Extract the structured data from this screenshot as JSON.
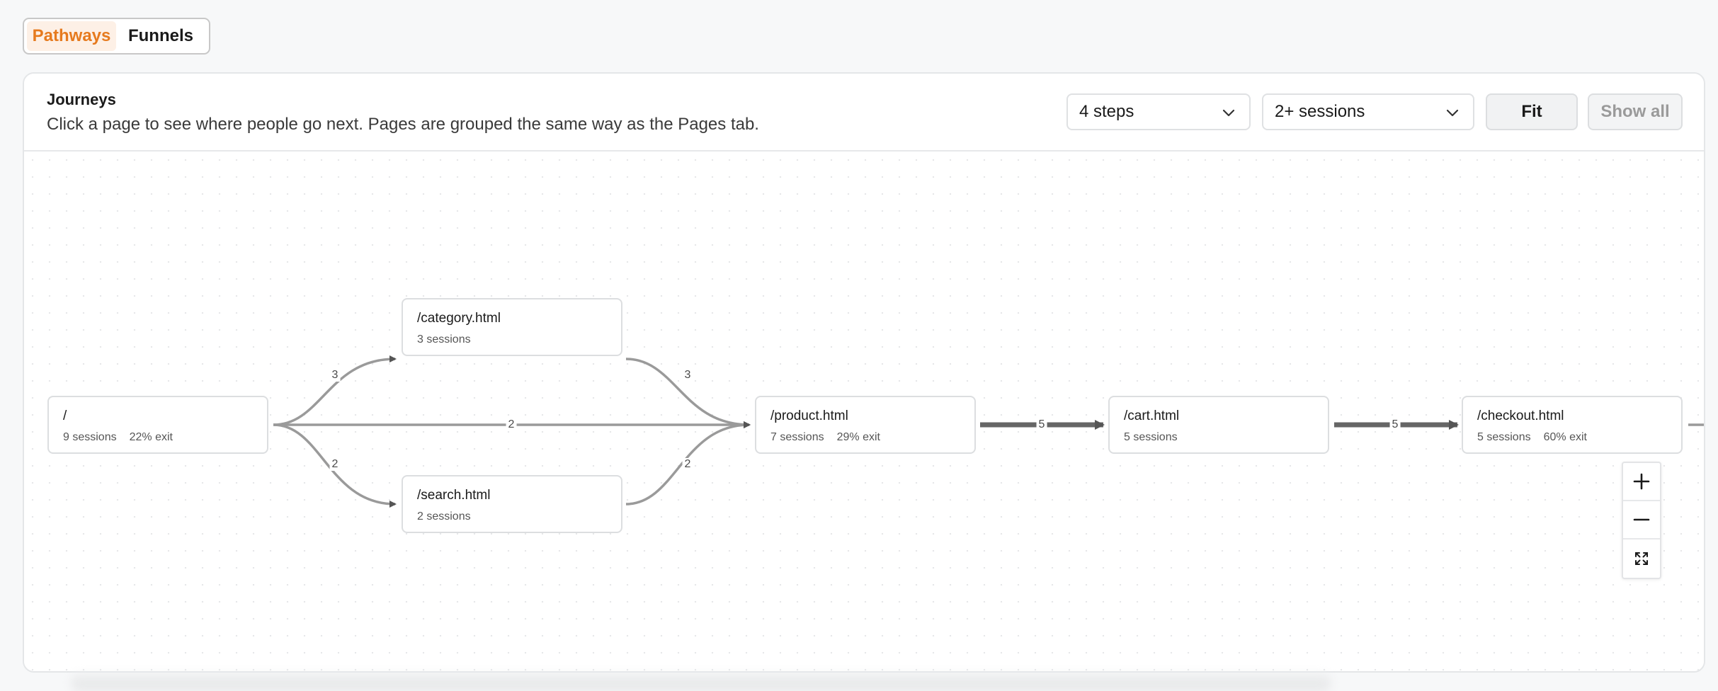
{
  "tabs": {
    "pathways": "Pathways",
    "funnels": "Funnels"
  },
  "panel": {
    "title": "Journeys",
    "subtitle": "Click a page to see where people go next. Pages are grouped the same way as the Pages tab."
  },
  "controls": {
    "steps": "4 steps",
    "sessions": "2+ sessions",
    "fit": "Fit",
    "show_all": "Show all"
  },
  "nodes": {
    "root": {
      "path": "/",
      "sessions": "9 sessions",
      "exit": "22% exit"
    },
    "category": {
      "path": "/category.html",
      "sessions": "3 sessions"
    },
    "search": {
      "path": "/search.html",
      "sessions": "2 sessions"
    },
    "product": {
      "path": "/product.html",
      "sessions": "7 sessions",
      "exit": "29% exit"
    },
    "cart": {
      "path": "/cart.html",
      "sessions": "5 sessions"
    },
    "checkout": {
      "path": "/checkout.html",
      "sessions": "5 sessions",
      "exit": "60% exit"
    }
  },
  "edges": {
    "root_category": "3",
    "root_product": "2",
    "root_search": "2",
    "category_product": "3",
    "search_product": "2",
    "product_cart": "5",
    "cart_checkout": "5"
  },
  "colors": {
    "accent": "#e67a1e",
    "edge": "#9a9a9a",
    "edge_strong": "#666666"
  },
  "icons": {
    "zoom_in": "plus-icon",
    "zoom_out": "minus-icon",
    "fit_view": "expand-icon"
  }
}
